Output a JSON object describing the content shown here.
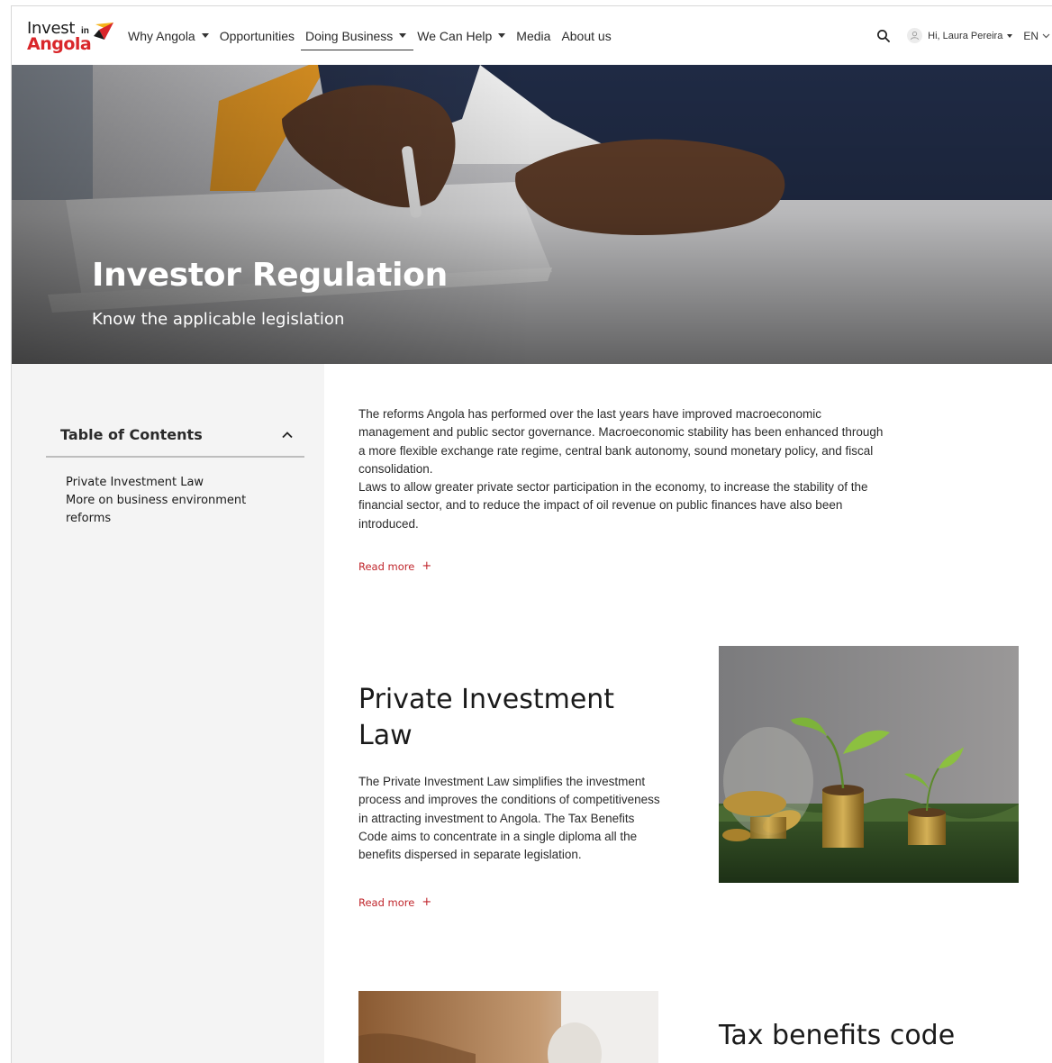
{
  "header": {
    "logo": {
      "line1": "Invest",
      "in": "in",
      "line2": "Angola"
    },
    "nav": [
      {
        "label": "Why Angola",
        "dropdown": true
      },
      {
        "label": "Opportunities",
        "dropdown": false
      },
      {
        "label": "Doing Business",
        "dropdown": true,
        "active": true
      },
      {
        "label": "We Can Help",
        "dropdown": true
      },
      {
        "label": "Media",
        "dropdown": false
      },
      {
        "label": "About us",
        "dropdown": false
      }
    ],
    "user_greeting": "Hi, Laura Pereira",
    "language": "EN"
  },
  "hero": {
    "title": "Investor Regulation",
    "subtitle": "Know the applicable legislation"
  },
  "toc": {
    "title": "Table of Contents",
    "items": [
      "Private Investment Law",
      "More on business environment reforms"
    ]
  },
  "intro": {
    "paragraph1": "The reforms Angola has performed over the last years have improved macroeconomic management and public sector governance. Macroeconomic stability has been enhanced through a more flexible exchange rate regime, central bank autonomy, sound monetary policy, and fiscal consolidation.",
    "paragraph2": "Laws to allow greater private sector participation in the economy, to increase the stability of the financial sector, and to reduce the impact of oil revenue on public finances have also been introduced.",
    "read_more": "Read more"
  },
  "private_investment": {
    "title": "Private Investment Law",
    "text": "The Private Investment Law simplifies the investment process and improves the conditions of competitiveness in attracting investment to Angola. The Tax Benefits Code aims to concentrate in a single diploma all the benefits dispersed in separate legislation.",
    "read_more": "Read more"
  },
  "tax_benefits": {
    "title": "Tax benefits code"
  },
  "colors": {
    "accent_red": "#c0262c",
    "logo_red": "#d9262a",
    "sidebar_bg": "#f4f4f4"
  }
}
